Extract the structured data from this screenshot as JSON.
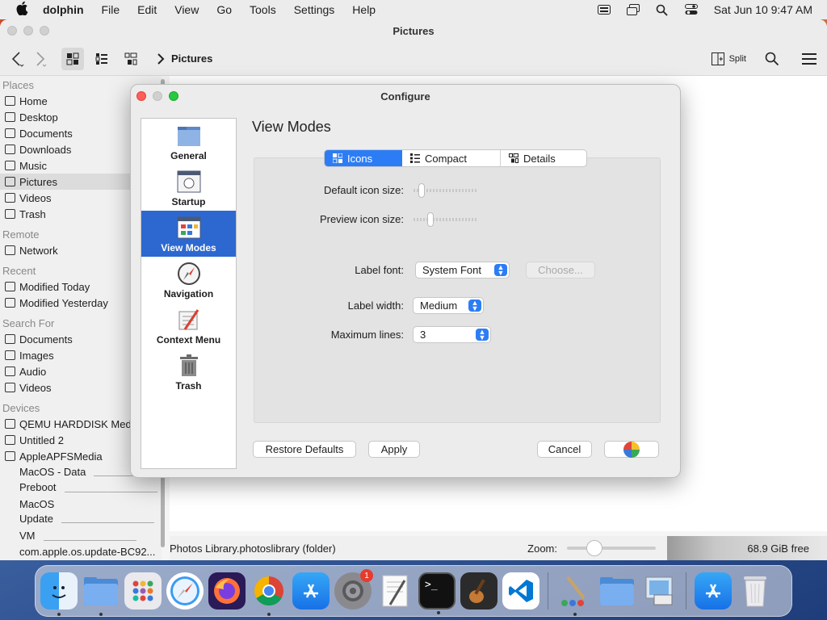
{
  "menubar": {
    "app_name": "dolphin",
    "items": [
      "File",
      "Edit",
      "View",
      "Go",
      "Tools",
      "Settings",
      "Help"
    ],
    "clock": "Sat Jun 10  9:47 AM"
  },
  "window": {
    "title": "Pictures",
    "breadcrumb": "Pictures",
    "split_label": "Split"
  },
  "sidebar": {
    "places_header": "Places",
    "places": [
      {
        "label": "Home",
        "icon": "home-icon"
      },
      {
        "label": "Desktop",
        "icon": "desktop-icon"
      },
      {
        "label": "Documents",
        "icon": "documents-icon"
      },
      {
        "label": "Downloads",
        "icon": "downloads-icon"
      },
      {
        "label": "Music",
        "icon": "music-icon"
      },
      {
        "label": "Pictures",
        "icon": "pictures-icon"
      },
      {
        "label": "Videos",
        "icon": "videos-icon"
      },
      {
        "label": "Trash",
        "icon": "trash-icon"
      }
    ],
    "remote_header": "Remote",
    "remote": [
      {
        "label": "Network",
        "icon": "network-icon"
      }
    ],
    "recent_header": "Recent",
    "recent": [
      {
        "label": "Modified Today",
        "icon": "calendar-icon"
      },
      {
        "label": "Modified Yesterday",
        "icon": "calendar-icon"
      }
    ],
    "search_header": "Search For",
    "search": [
      {
        "label": "Documents",
        "icon": "documents-icon"
      },
      {
        "label": "Images",
        "icon": "images-icon"
      },
      {
        "label": "Audio",
        "icon": "audio-icon"
      },
      {
        "label": "Videos",
        "icon": "videos-icon"
      }
    ],
    "devices_header": "Devices",
    "devices": [
      {
        "label": "QEMU HARDDISK Media"
      },
      {
        "label": "Untitled 2"
      },
      {
        "label": "AppleAPFSMedia"
      }
    ],
    "sub_volumes": [
      "MacOS - Data",
      "Preboot",
      "MacOS",
      "Update",
      "VM",
      "com.apple.os.update-BC92..."
    ]
  },
  "statusbar": {
    "selection": "Photos Library.photoslibrary (folder)",
    "zoom_label": "Zoom:",
    "zoom_fraction": 0.25,
    "free_space": "68.9 GiB free"
  },
  "dialog": {
    "title": "Configure",
    "categories": [
      "General",
      "Startup",
      "View Modes",
      "Navigation",
      "Context Menu",
      "Trash"
    ],
    "active_category": "View Modes",
    "pane_title": "View Modes",
    "tabs": [
      "Icons",
      "Compact",
      "Details"
    ],
    "labels": {
      "default_icon_size": "Default icon size:",
      "preview_icon_size": "Preview icon size:",
      "label_font": "Label font:",
      "label_width": "Label width:",
      "maximum_lines": "Maximum lines:"
    },
    "values": {
      "label_font": "System Font",
      "label_width": "Medium",
      "maximum_lines": "3",
      "choose": "Choose..."
    },
    "buttons": {
      "restore": "Restore Defaults",
      "apply": "Apply",
      "cancel": "Cancel"
    }
  },
  "colors": {
    "accent": "#2c7df5",
    "selection": "#2c68d0",
    "close": "#fe5f57",
    "minimize": "#febc2e",
    "zoom": "#28c840"
  },
  "dock": [
    "Finder",
    "Files",
    "Launchpad",
    "Safari",
    "Firefox",
    "Chrome",
    "App Store",
    "System Preferences",
    "TextEdit",
    "Terminal",
    "GarageBand",
    "VS Code",
    "Paintbrush",
    "Folder",
    "Preview",
    "App Store",
    "Trash"
  ],
  "dock_badge": "1"
}
